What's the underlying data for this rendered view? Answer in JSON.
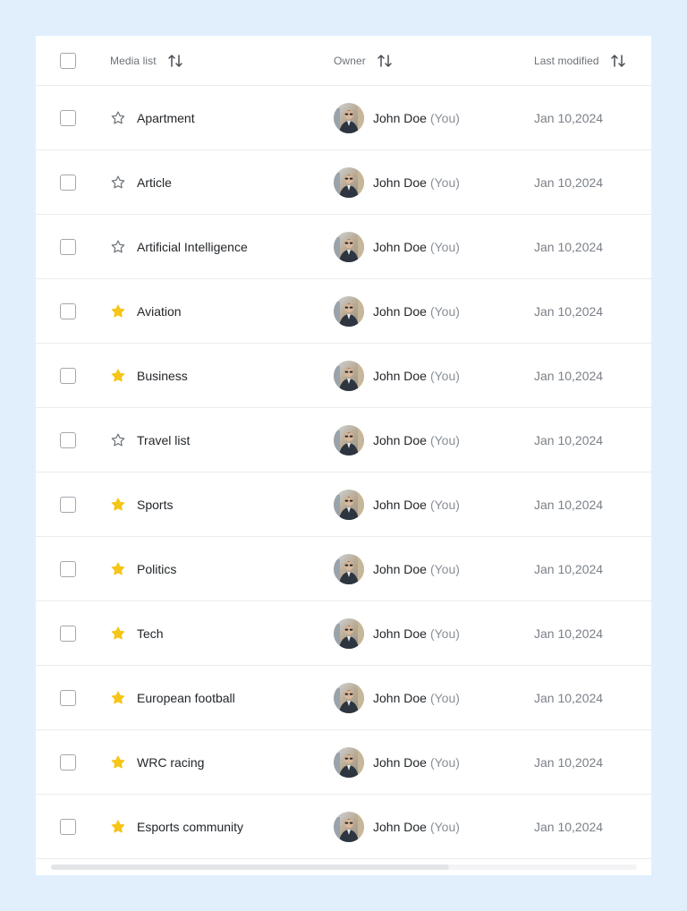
{
  "header": {
    "col_name": "Media list",
    "col_owner": "Owner",
    "col_modified": "Last modified"
  },
  "colors": {
    "background": "#e1effd",
    "star_filled": "#f5c518",
    "star_outline": "#6c7278"
  },
  "rows": [
    {
      "name": "Apartment",
      "starred": false,
      "owner": "John Doe",
      "owner_suffix": "(You)",
      "modified": "Jan 10,2024"
    },
    {
      "name": "Article",
      "starred": false,
      "owner": "John Doe",
      "owner_suffix": "(You)",
      "modified": "Jan 10,2024"
    },
    {
      "name": "Artificial Intelligence",
      "starred": false,
      "owner": "John Doe",
      "owner_suffix": "(You)",
      "modified": "Jan 10,2024"
    },
    {
      "name": "Aviation",
      "starred": true,
      "owner": "John Doe",
      "owner_suffix": "(You)",
      "modified": "Jan 10,2024"
    },
    {
      "name": "Business",
      "starred": true,
      "owner": "John Doe",
      "owner_suffix": "(You)",
      "modified": "Jan 10,2024"
    },
    {
      "name": "Travel list",
      "starred": false,
      "owner": "John Doe",
      "owner_suffix": "(You)",
      "modified": "Jan 10,2024"
    },
    {
      "name": "Sports",
      "starred": true,
      "owner": "John Doe",
      "owner_suffix": "(You)",
      "modified": "Jan 10,2024"
    },
    {
      "name": "Politics",
      "starred": true,
      "owner": "John Doe",
      "owner_suffix": "(You)",
      "modified": "Jan 10,2024"
    },
    {
      "name": "Tech",
      "starred": true,
      "owner": "John Doe",
      "owner_suffix": "(You)",
      "modified": "Jan 10,2024"
    },
    {
      "name": "European football",
      "starred": true,
      "owner": "John Doe",
      "owner_suffix": "(You)",
      "modified": "Jan 10,2024"
    },
    {
      "name": "WRC racing",
      "starred": true,
      "owner": "John Doe",
      "owner_suffix": "(You)",
      "modified": "Jan 10,2024"
    },
    {
      "name": "Esports community",
      "starred": true,
      "owner": "John Doe",
      "owner_suffix": "(You)",
      "modified": "Jan 10,2024"
    }
  ],
  "scrollbar": {
    "position": 0.0,
    "visible_fraction": 0.68
  }
}
